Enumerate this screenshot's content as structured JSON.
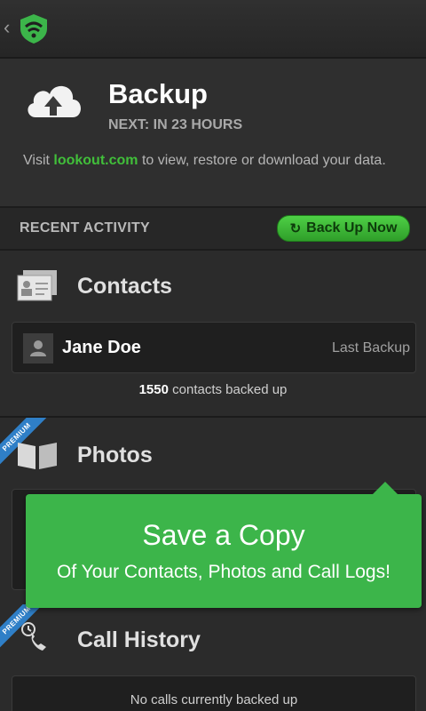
{
  "header": {
    "title": "Backup",
    "next": "NEXT: IN 23 HOURS",
    "desc_prefix": "Visit ",
    "desc_link": "lookout.com",
    "desc_suffix": " to view, restore or download your data."
  },
  "recent": {
    "label": "RECENT ACTIVITY",
    "button": "Back Up Now"
  },
  "contacts": {
    "title": "Contacts",
    "name": "Jane Doe",
    "last_backup": "Last Backup",
    "count": "1550",
    "count_text": " contacts backed up"
  },
  "photos": {
    "title": "Photos",
    "badge": "PREMIUM"
  },
  "calls": {
    "title": "Call History",
    "badge": "PREMIUM",
    "empty": "No calls currently backed up"
  },
  "tooltip": {
    "title": "Save a Copy",
    "subtitle": "Of Your Contacts, Photos and Call Logs!"
  },
  "colors": {
    "accent": "#41bf3a",
    "tooltip": "#3cb54a",
    "premium": "#2f7fc7"
  }
}
